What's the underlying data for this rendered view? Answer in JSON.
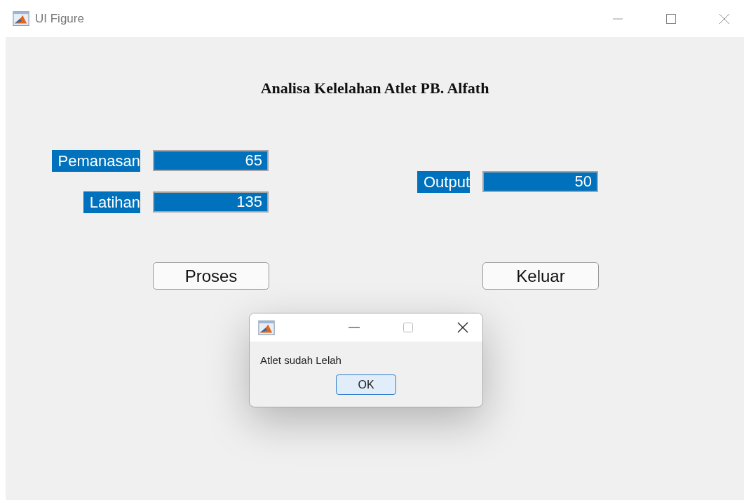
{
  "window": {
    "title": "UI Figure"
  },
  "heading": "Analisa Kelelahan Atlet PB. Alfath",
  "inputs": [
    {
      "label": "Pemanasan",
      "value": "65"
    },
    {
      "label": "Latihan",
      "value": "135"
    }
  ],
  "output": {
    "label": "Output",
    "value": "50"
  },
  "buttons": [
    "Proses",
    "Keluar"
  ],
  "dialog": {
    "message": "Atlet sudah Lelah",
    "button": "OK"
  }
}
